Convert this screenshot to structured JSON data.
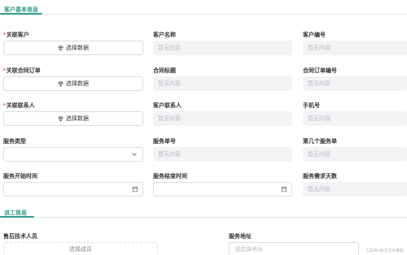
{
  "sections": {
    "customer_info": "客户基本信息",
    "dispatch_info": "派工信息"
  },
  "required_mark": "*",
  "fields": {
    "linked_customer": {
      "label": "关联客户",
      "button": "选择数据"
    },
    "customer_name": {
      "label": "客户名称",
      "placeholder": "暂无内容"
    },
    "customer_number": {
      "label": "客户编号",
      "placeholder": "暂无内容"
    },
    "linked_contract_order": {
      "label": "关联合同订单",
      "button": "选择数据"
    },
    "contract_title": {
      "label": "合同标题",
      "placeholder": "暂无内容"
    },
    "contract_order_number": {
      "label": "合同订单编号",
      "placeholder": "暂无内容"
    },
    "linked_contact": {
      "label": "关联联系人",
      "button": "选择数据"
    },
    "customer_contact": {
      "label": "客户联系人",
      "placeholder": "暂无内容"
    },
    "mobile": {
      "label": "手机号",
      "placeholder": "暂无内容"
    },
    "service_type": {
      "label": "服务类型",
      "value": ""
    },
    "service_number": {
      "label": "服务单号",
      "placeholder": "暂无内容"
    },
    "nth_service": {
      "label": "第几个服务单",
      "placeholder": "暂无内容"
    },
    "service_start": {
      "label": "服务开始时间"
    },
    "service_end": {
      "label": "服务结束时间"
    },
    "service_days": {
      "label": "服务需求天数",
      "placeholder": "暂无内容"
    },
    "after_sales_tech": {
      "label": "售后技术人员",
      "button": "选择成员"
    },
    "service_address": {
      "label": "服务地址",
      "placeholder": "请选择地址"
    }
  },
  "watermark": "CSDN @汉卫大侠玩",
  "colors": {
    "accent": "#2f9b88",
    "required": "#e5484d"
  },
  "icons": {
    "pick": "gem-icon",
    "dropdown": "chevron-down-icon",
    "date": "calendar-icon"
  }
}
